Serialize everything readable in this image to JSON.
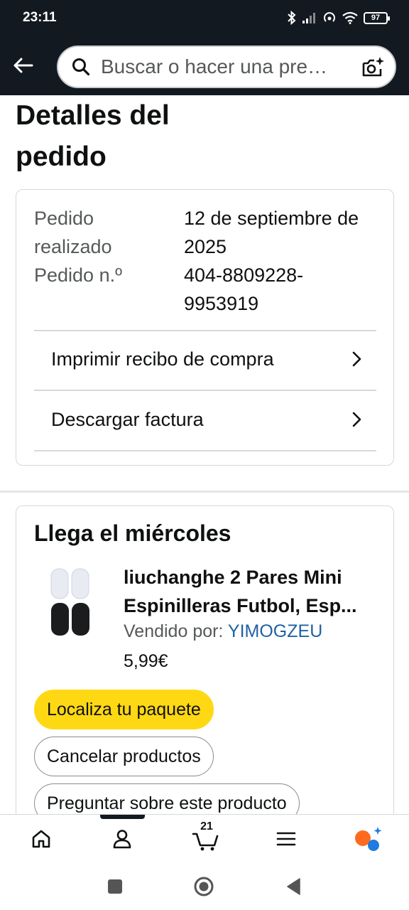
{
  "status_bar": {
    "time": "23:11",
    "battery": "97"
  },
  "header": {
    "search_placeholder": "Buscar o hacer una pre…",
    "icons": {
      "back": "arrow-left-icon",
      "search": "search-icon",
      "camera": "camera-lens-icon"
    }
  },
  "page": {
    "title": "Detalles del pedido"
  },
  "order": {
    "placed_label": "Pedido realizado",
    "placed_value": "12 de septiembre de 2025",
    "number_label": "Pedido n.º",
    "number_value": "404-8809228-9953919",
    "actions": [
      {
        "label": "Imprimir recibo de compra"
      },
      {
        "label": "Descargar factura"
      }
    ]
  },
  "shipment": {
    "title": "Llega el miércoles",
    "product_name": "liuchanghe 2 Pares Mini Espinilleras Futbol, Esp...",
    "seller_prefix": "Vendido por:",
    "seller_name": "YIMOGZEU",
    "price": "5,99€",
    "buttons": {
      "track": "Localiza tu paquete",
      "cancel": "Cancelar productos",
      "ask": "Preguntar sobre este producto"
    }
  },
  "bottom_nav": {
    "cart_count": "21",
    "items": [
      "home-icon",
      "account-icon",
      "cart-icon",
      "menu-icon",
      "rufus-assistant-icon"
    ]
  },
  "system_nav": {
    "items": [
      "recents-square-icon",
      "home-circle-icon",
      "back-triangle-icon"
    ]
  },
  "colors": {
    "header_bg": "#131921",
    "primary_button": "#ffd814",
    "link": "#2162a1",
    "text": "#0f1111",
    "muted": "#565959"
  }
}
